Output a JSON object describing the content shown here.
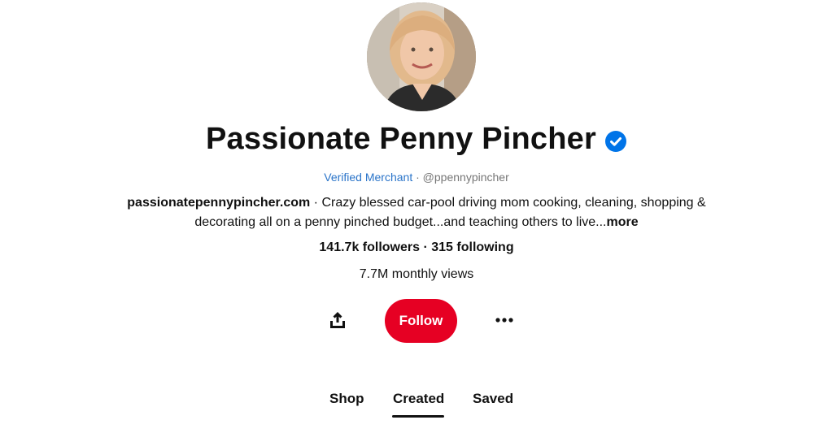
{
  "profile": {
    "name": "Passionate Penny Pincher",
    "verified_icon": "verified-checkmark-icon",
    "merchant_label": "Verified Merchant",
    "separator": " · ",
    "handle": "@ppennypincher",
    "website": "passionatepennypincher.com",
    "bio_separator": " · ",
    "bio": "Crazy blessed car-pool driving mom cooking, cleaning, shopping & decorating all on a penny pinched budget...and teaching others to live...",
    "bio_more": "more",
    "followers": "141.7k followers",
    "stats_separator": " · ",
    "following": "315 following",
    "monthly_views": "7.7M monthly views"
  },
  "actions": {
    "share_icon": "share-icon",
    "follow_label": "Follow",
    "more_icon": "more-options-icon"
  },
  "tabs": [
    {
      "label": "Shop",
      "active": false
    },
    {
      "label": "Created",
      "active": true
    },
    {
      "label": "Saved",
      "active": false
    }
  ],
  "colors": {
    "accent": "#e60023",
    "verified": "#2a74c9",
    "text": "#111111",
    "muted": "#767676"
  }
}
